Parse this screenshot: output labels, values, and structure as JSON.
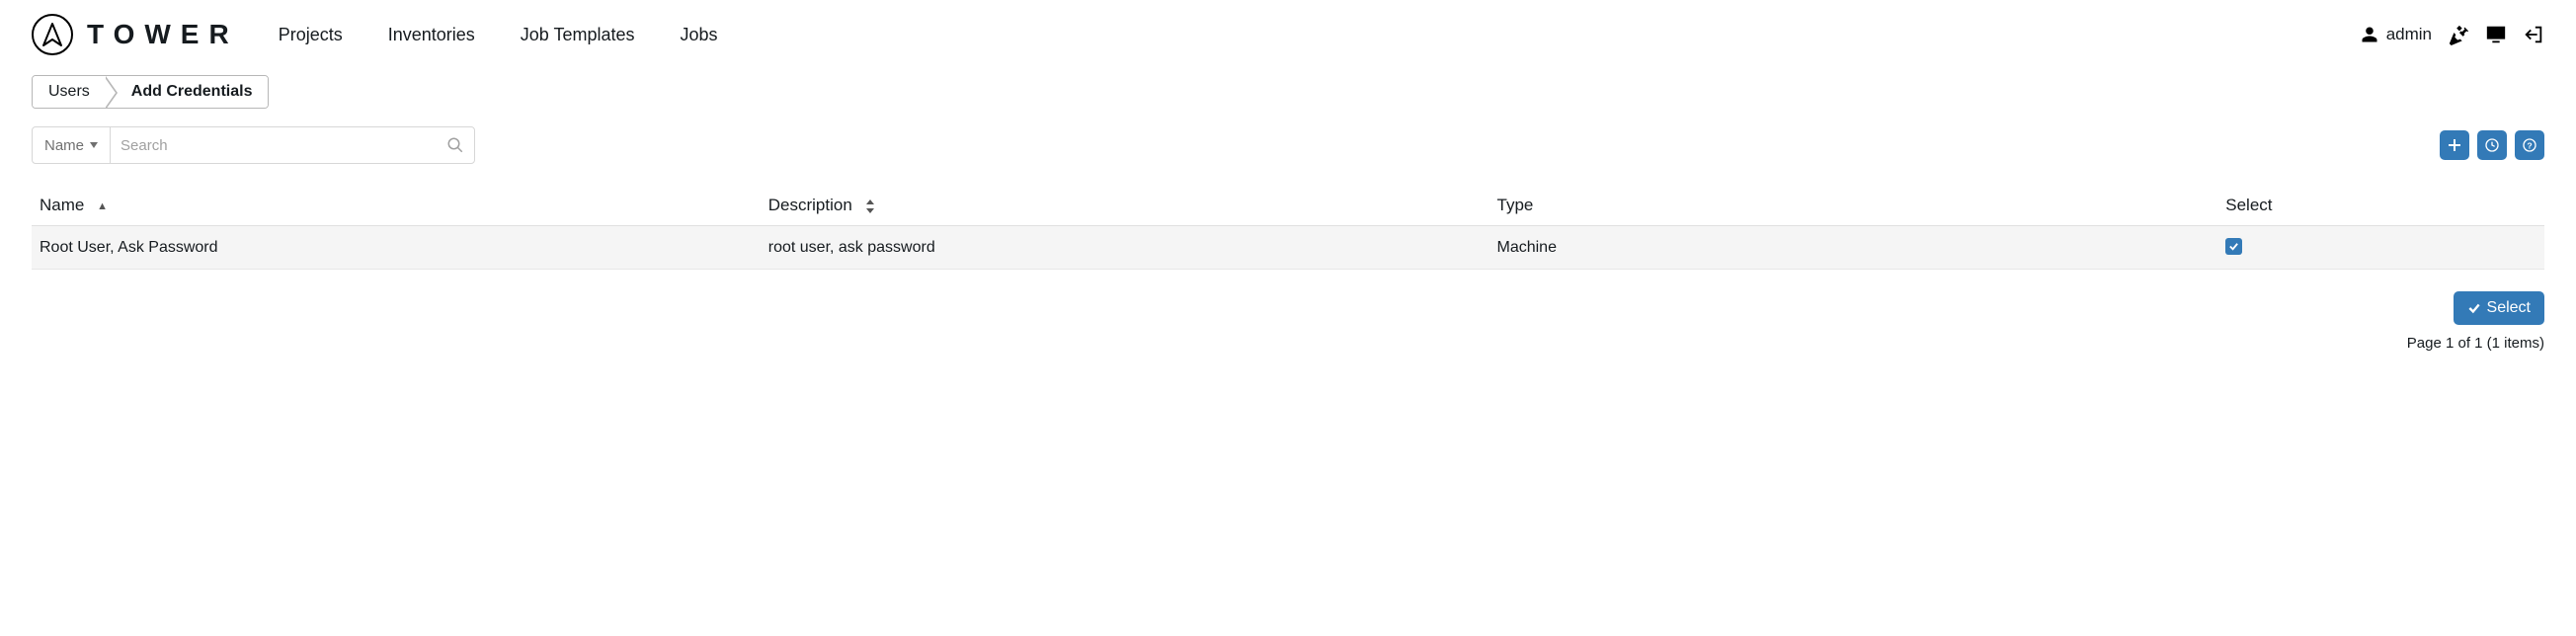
{
  "brand": {
    "name": "TOWER"
  },
  "nav": {
    "projects": "Projects",
    "inventories": "Inventories",
    "job_templates": "Job Templates",
    "jobs": "Jobs"
  },
  "user": {
    "name": "admin"
  },
  "breadcrumb": {
    "users": "Users",
    "add_credentials": "Add Credentials"
  },
  "search": {
    "filter_label": "Name",
    "placeholder": "Search"
  },
  "table": {
    "headers": {
      "name": "Name",
      "description": "Description",
      "type": "Type",
      "select": "Select"
    },
    "rows": [
      {
        "name": "Root User, Ask Password",
        "description": "root user, ask password",
        "type": "Machine",
        "selected": true
      }
    ]
  },
  "footer": {
    "select_label": "Select",
    "page_info": "Page 1 of 1 (1 items)"
  }
}
